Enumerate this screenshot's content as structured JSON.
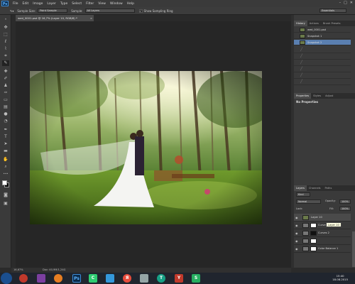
{
  "app": {
    "logo": "Ps"
  },
  "menu": [
    "File",
    "Edit",
    "Image",
    "Layer",
    "Type",
    "Select",
    "Filter",
    "View",
    "Window",
    "Help"
  ],
  "window_controls": [
    "–",
    "□",
    "✕"
  ],
  "options": {
    "sample_size_label": "Sample Size:",
    "sample_size_value": "Point Sample",
    "sample_label": "Sample:",
    "sample_value": "All Layers",
    "show_ring_label": "Show Sampling Ring",
    "show_ring_checked": "✓",
    "workspace": "Essentials"
  },
  "document": {
    "tab_title": "wed_0001.psd @ 16,7% (Layer 10, RGB/8) *",
    "close": "×"
  },
  "status": {
    "zoom": "16,67%",
    "doc": "Doc: 40,9M/1,24G"
  },
  "history": {
    "tabs": [
      "History",
      "Actions",
      "Brush Presets"
    ],
    "items": [
      {
        "label": "wed_0001.psd"
      },
      {
        "label": "Snapshot 1"
      },
      {
        "label": "Snapshot 2"
      }
    ]
  },
  "properties": {
    "tabs": [
      "Properties",
      "Styles",
      "Adjust"
    ],
    "empty_text": "No Properties"
  },
  "layers": {
    "tabs": [
      "Layers",
      "Channels",
      "Paths"
    ],
    "filter": "Kind",
    "blend_mode": "Normal",
    "opacity_label": "Opacity:",
    "opacity_value": "100%",
    "lock_label": "Lock:",
    "fill_label": "Fill:",
    "fill_value": "100%",
    "tooltip": "Layer 10",
    "items": [
      {
        "name": "Layer 10"
      },
      {
        "name": "Curves 1"
      },
      {
        "name": "Curves 2"
      },
      {
        "name": ""
      },
      {
        "name": "Color Balance 1"
      }
    ]
  },
  "taskbar": {
    "icons": [
      "Ps",
      "C",
      "Я",
      "T",
      "Y",
      "S"
    ],
    "time": "15:40",
    "date": "18.08.2015"
  },
  "colors": {
    "selection": "#5a7fb0",
    "ps_blue": "#3d8bd6"
  }
}
